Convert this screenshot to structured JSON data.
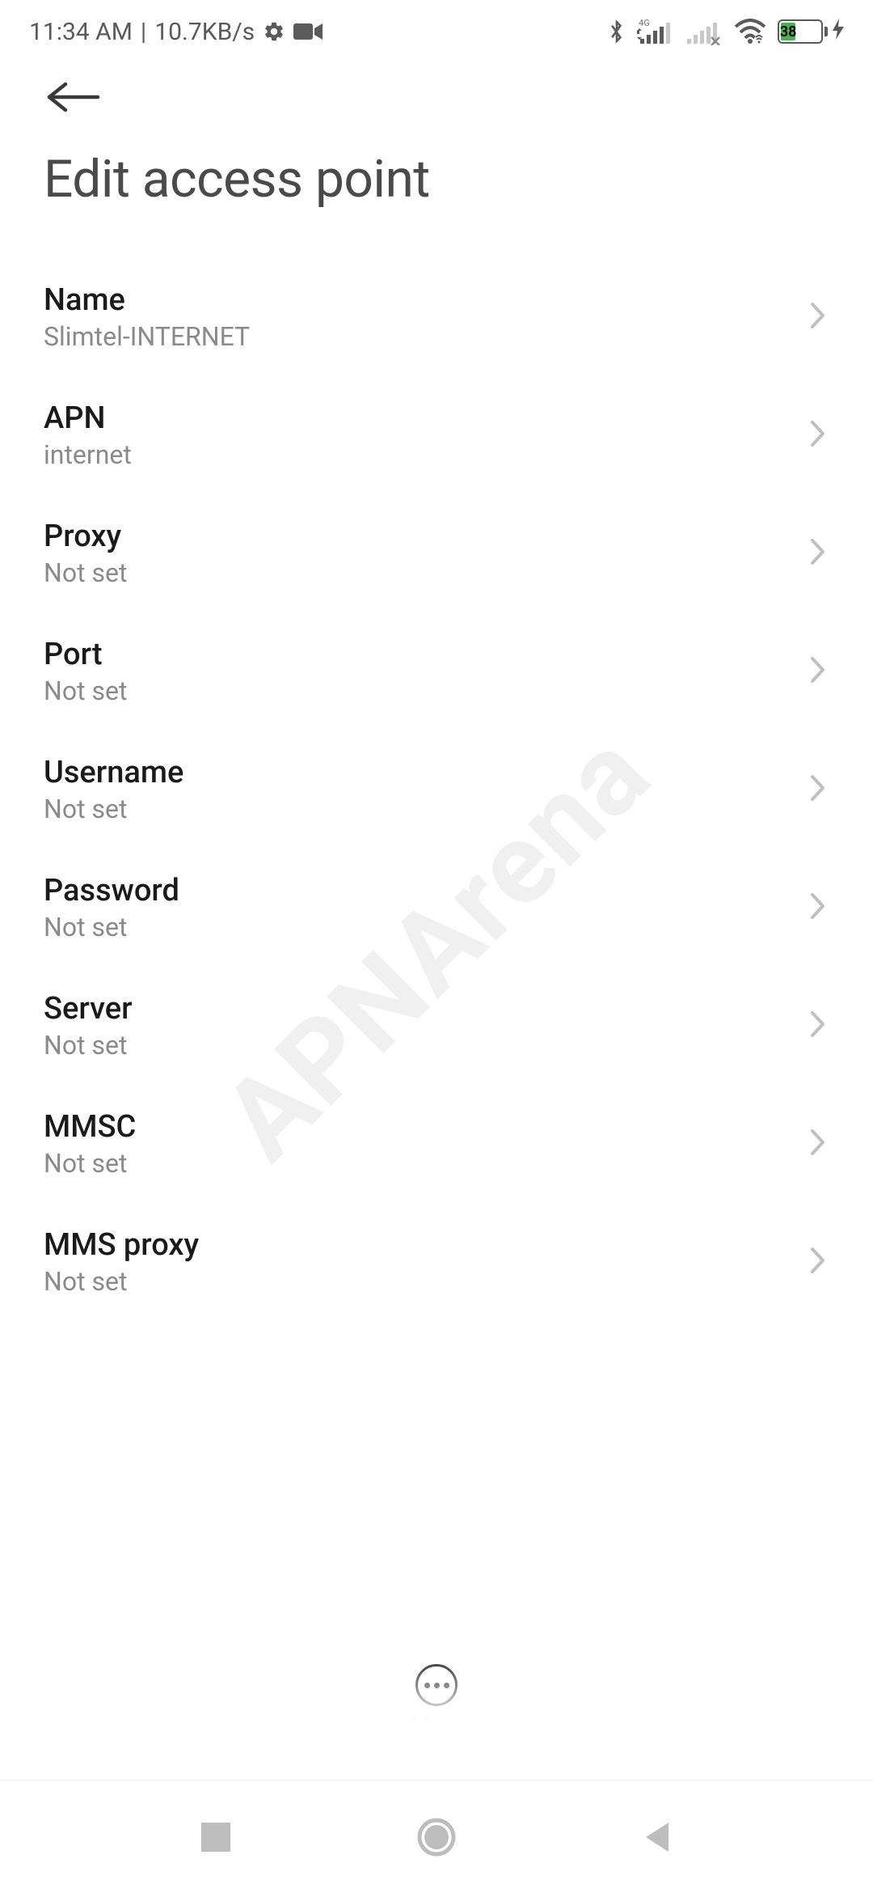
{
  "status_bar": {
    "time": "11:34 AM",
    "data_rate": "10.7KB/s",
    "network_type": "4G",
    "battery_percent": "38"
  },
  "page_title": "Edit access point",
  "settings": [
    {
      "label": "Name",
      "value": "Slimtel-INTERNET"
    },
    {
      "label": "APN",
      "value": "internet"
    },
    {
      "label": "Proxy",
      "value": "Not set"
    },
    {
      "label": "Port",
      "value": "Not set"
    },
    {
      "label": "Username",
      "value": "Not set"
    },
    {
      "label": "Password",
      "value": "Not set"
    },
    {
      "label": "Server",
      "value": "Not set"
    },
    {
      "label": "MMSC",
      "value": "Not set"
    },
    {
      "label": "MMS proxy",
      "value": "Not set"
    }
  ],
  "more_label": "More",
  "watermark_text": "APNArena"
}
